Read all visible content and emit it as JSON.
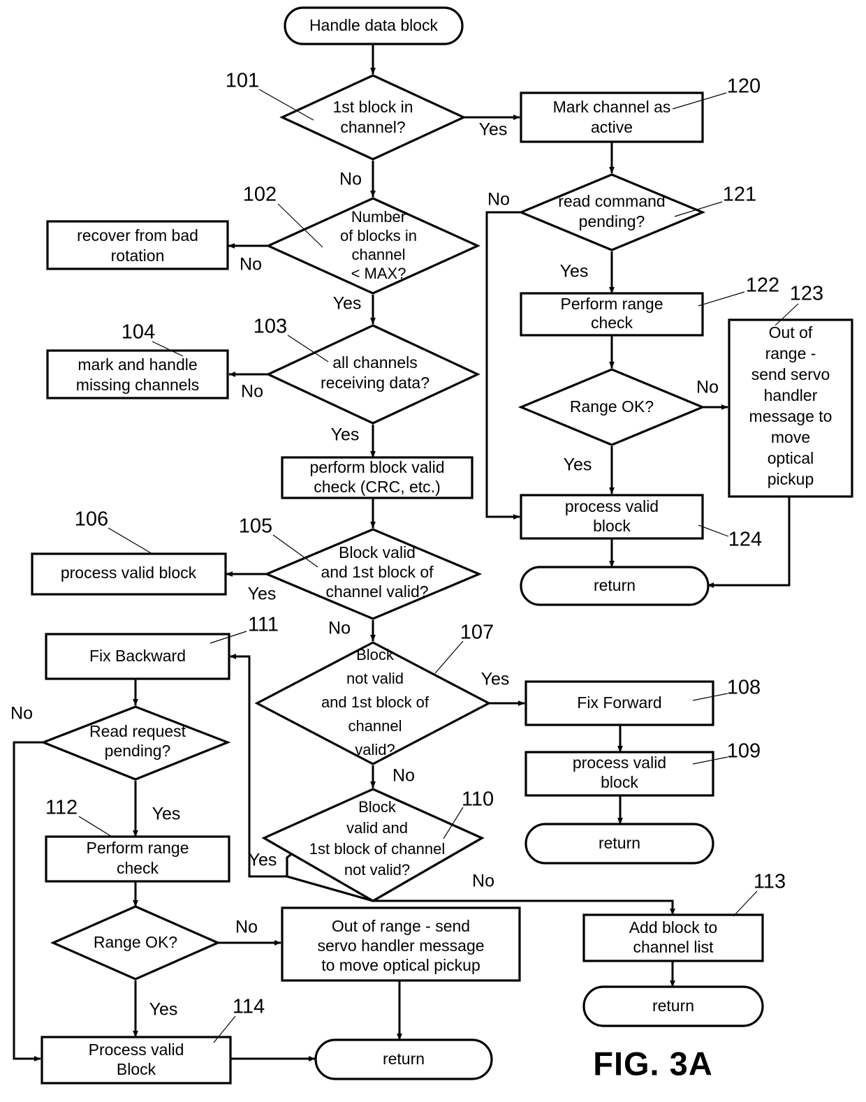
{
  "figure": {
    "label": "FIG. 3A",
    "title": "Handle data block"
  },
  "nodes": {
    "start": {
      "id": "start",
      "type": "terminal",
      "text": [
        "Handle data block"
      ],
      "ref": ""
    },
    "n101": {
      "id": "101",
      "type": "decision",
      "text": [
        "1st block in",
        "channel?"
      ],
      "ref": "101"
    },
    "n120": {
      "id": "120",
      "type": "process",
      "text": [
        "Mark channel as",
        "active"
      ],
      "ref": "120"
    },
    "n121": {
      "id": "121",
      "type": "decision",
      "text": [
        "read command",
        "pending?"
      ],
      "ref": "121"
    },
    "n102": {
      "id": "102",
      "type": "decision",
      "text": [
        "Number",
        "of blocks in",
        "channel",
        "< MAX?"
      ],
      "ref": "102"
    },
    "recover": {
      "id": "recover",
      "type": "process",
      "text": [
        "recover from bad",
        "rotation"
      ],
      "ref": ""
    },
    "n122": {
      "id": "122",
      "type": "process",
      "text": [
        "Perform  range",
        "check"
      ],
      "ref": "122"
    },
    "n123": {
      "id": "123",
      "type": "process",
      "text": [
        "Out of",
        "range -",
        "send servo",
        "handler",
        "message to",
        "move",
        "optical",
        "pickup"
      ],
      "ref": "123"
    },
    "rangeok_top": {
      "id": "rangeok_top",
      "type": "decision",
      "text": [
        "Range OK?"
      ],
      "ref": ""
    },
    "n103": {
      "id": "103",
      "type": "decision",
      "text": [
        "all channels",
        "receiving data?"
      ],
      "ref": "103"
    },
    "n104": {
      "id": "104",
      "type": "process",
      "text": [
        "mark and handle",
        "missing channels"
      ],
      "ref": "104"
    },
    "n124": {
      "id": "124",
      "type": "process",
      "text": [
        "process valid",
        "block"
      ],
      "ref": "124"
    },
    "return_top": {
      "id": "return_top",
      "type": "terminal",
      "text": [
        "return"
      ],
      "ref": ""
    },
    "crc": {
      "id": "crc",
      "type": "process",
      "text": [
        "perform block valid",
        "check (CRC, etc.)"
      ],
      "ref": ""
    },
    "n105": {
      "id": "105",
      "type": "decision",
      "text": [
        "Block  valid",
        "and 1st block of",
        "channel valid?"
      ],
      "ref": "105"
    },
    "n106": {
      "id": "106",
      "type": "process",
      "text": [
        "process valid block"
      ],
      "ref": "106"
    },
    "n111": {
      "id": "111",
      "type": "process",
      "text": [
        "Fix  Backward"
      ],
      "ref": "111"
    },
    "n107": {
      "id": "107",
      "type": "decision",
      "text": [
        "Block",
        "not valid",
        "and 1st block of",
        "channel",
        "valid?"
      ],
      "ref": "107"
    },
    "n108": {
      "id": "108",
      "type": "process",
      "text": [
        "Fix Forward"
      ],
      "ref": "108"
    },
    "n109": {
      "id": "109",
      "type": "process",
      "text": [
        "process valid",
        "block"
      ],
      "ref": "109"
    },
    "return_mid": {
      "id": "return_mid",
      "type": "terminal",
      "text": [
        "return"
      ],
      "ref": ""
    },
    "readreq": {
      "id": "readreq",
      "type": "decision",
      "text": [
        "Read request",
        "pending?"
      ],
      "ref": ""
    },
    "n112": {
      "id": "112",
      "type": "process",
      "text": [
        "Perform  range",
        "check"
      ],
      "ref": "112"
    },
    "n110": {
      "id": "110",
      "type": "decision",
      "text": [
        "Block",
        "valid and",
        "1st block of channel",
        "not valid?"
      ],
      "ref": "110"
    },
    "n113": {
      "id": "113",
      "type": "process",
      "text": [
        "Add  block  to",
        "channel list"
      ],
      "ref": "113"
    },
    "return_bot_right": {
      "id": "return_bot_right",
      "type": "terminal",
      "text": [
        "return"
      ],
      "ref": ""
    },
    "rangeok_bot": {
      "id": "rangeok_bot",
      "type": "decision",
      "text": [
        "Range OK?"
      ],
      "ref": ""
    },
    "outrange_bot": {
      "id": "outrange_bot",
      "type": "process",
      "text": [
        "Out of range - send",
        "servo handler message",
        "to move optical pickup"
      ],
      "ref": ""
    },
    "n114": {
      "id": "114",
      "type": "process",
      "text": [
        "Process valid",
        "Block"
      ],
      "ref": "114"
    },
    "return_bot_left": {
      "id": "return_bot_left",
      "type": "terminal",
      "text": [
        "return"
      ],
      "ref": ""
    }
  },
  "edge_labels": {
    "e101_yes": "Yes",
    "e101_no": "No",
    "e102_no": "No",
    "e102_yes": "Yes",
    "e103_no": "No",
    "e103_yes": "Yes",
    "e121_no": "No",
    "e121_yes": "Yes",
    "e_rangeok_top_no": "No",
    "e_rangeok_top_yes": "Yes",
    "e105_yes": "Yes",
    "e105_no": "No",
    "e107_yes": "Yes",
    "e107_no": "No",
    "e110_yes": "Yes",
    "e110_no": "No",
    "e_readreq_no": "No",
    "e_readreq_yes": "Yes",
    "e_rangeok_bot_no": "No",
    "e_rangeok_bot_yes": "Yes"
  },
  "ref_numbers": [
    "101",
    "102",
    "103",
    "104",
    "105",
    "106",
    "107",
    "108",
    "109",
    "110",
    "111",
    "112",
    "113",
    "114",
    "120",
    "121",
    "122",
    "123",
    "124"
  ],
  "colors": {
    "stroke": "#000000",
    "fill": "#ffffff",
    "background": "#ffffff"
  }
}
